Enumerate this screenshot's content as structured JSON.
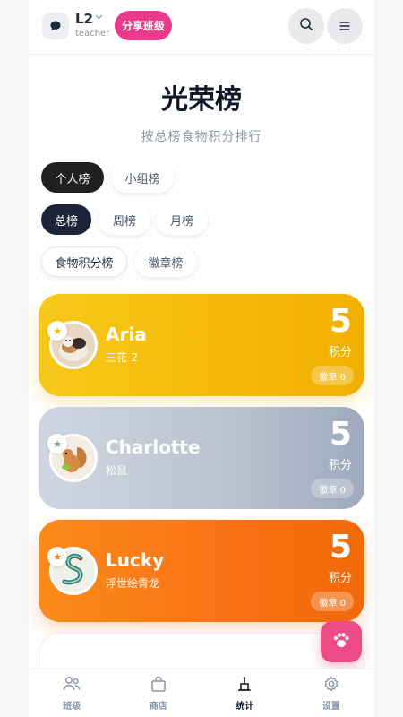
{
  "header": {
    "class_name": "L2",
    "role": "teacher",
    "share_label": "分享班级"
  },
  "title": "光荣榜",
  "subtitle": "按总榜食物积分排行",
  "filters": {
    "scope": [
      "个人榜",
      "小组榜"
    ],
    "period": [
      "总榜",
      "周榜",
      "月榜"
    ],
    "metric": [
      "食物积分榜",
      "徽章榜"
    ]
  },
  "leaderboard": [
    {
      "rank": 1,
      "name": "Aria",
      "pet": "三花-2",
      "score": "5",
      "unit": "积分",
      "badges": "徽章 0"
    },
    {
      "rank": 2,
      "name": "Charlotte",
      "pet": "松鼠",
      "score": "5",
      "unit": "积分",
      "badges": "徽章 0"
    },
    {
      "rank": 3,
      "name": "Lucky",
      "pet": "浮世绘青龙",
      "score": "5",
      "unit": "积分",
      "badges": "徽章 0"
    }
  ],
  "tabs": [
    {
      "label": "班级",
      "icon": "users-icon"
    },
    {
      "label": "商店",
      "icon": "shopping-bag-icon"
    },
    {
      "label": "统计",
      "icon": "podium-icon"
    },
    {
      "label": "设置",
      "icon": "gear-icon"
    }
  ],
  "colors": {
    "accent_pink": "#e8398a",
    "gold": "#f6b80a",
    "silver": "#bcc4d1",
    "orange": "#f97316"
  }
}
